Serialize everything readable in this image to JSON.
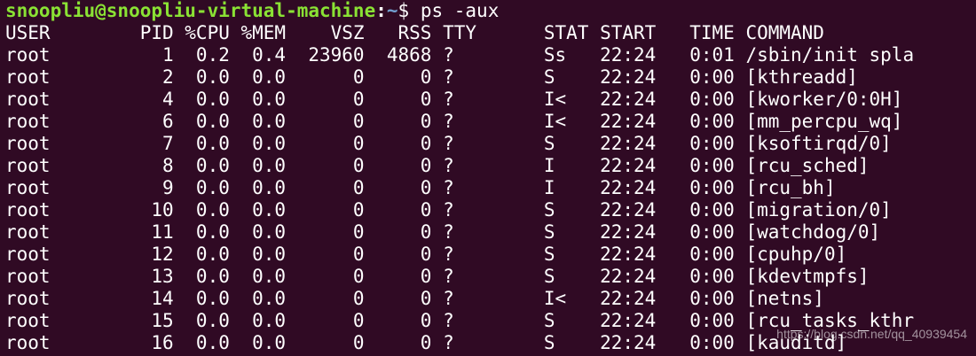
{
  "prompt": {
    "user_host": "snoopliu@snoopliu-virtual-machine",
    "separator": ":",
    "path": "~",
    "dollar": "$ ",
    "command": "ps -aux"
  },
  "header": "USER        PID %CPU %MEM    VSZ   RSS TTY      STAT START   TIME COMMAND",
  "rows": [
    "root          1  0.2  0.4  23960  4868 ?        Ss   22:24   0:01 /sbin/init spla",
    "root          2  0.0  0.0      0     0 ?        S    22:24   0:00 [kthreadd]",
    "root          4  0.0  0.0      0     0 ?        I<   22:24   0:00 [kworker/0:0H]",
    "root          6  0.0  0.0      0     0 ?        I<   22:24   0:00 [mm_percpu_wq]",
    "root          7  0.0  0.0      0     0 ?        S    22:24   0:00 [ksoftirqd/0]",
    "root          8  0.0  0.0      0     0 ?        I    22:24   0:00 [rcu_sched]",
    "root          9  0.0  0.0      0     0 ?        I    22:24   0:00 [rcu_bh]",
    "root         10  0.0  0.0      0     0 ?        S    22:24   0:00 [migration/0]",
    "root         11  0.0  0.0      0     0 ?        S    22:24   0:00 [watchdog/0]",
    "root         12  0.0  0.0      0     0 ?        S    22:24   0:00 [cpuhp/0]",
    "root         13  0.0  0.0      0     0 ?        S    22:24   0:00 [kdevtmpfs]",
    "root         14  0.0  0.0      0     0 ?        I<   22:24   0:00 [netns]",
    "root         15  0.0  0.0      0     0 ?        S    22:24   0:00 [rcu_tasks_kthr",
    "root         16  0.0  0.0      0     0 ?        S    22:24   0:00 [kauditd]"
  ],
  "watermark": "https://blog.csdn.net/qq_40939454"
}
